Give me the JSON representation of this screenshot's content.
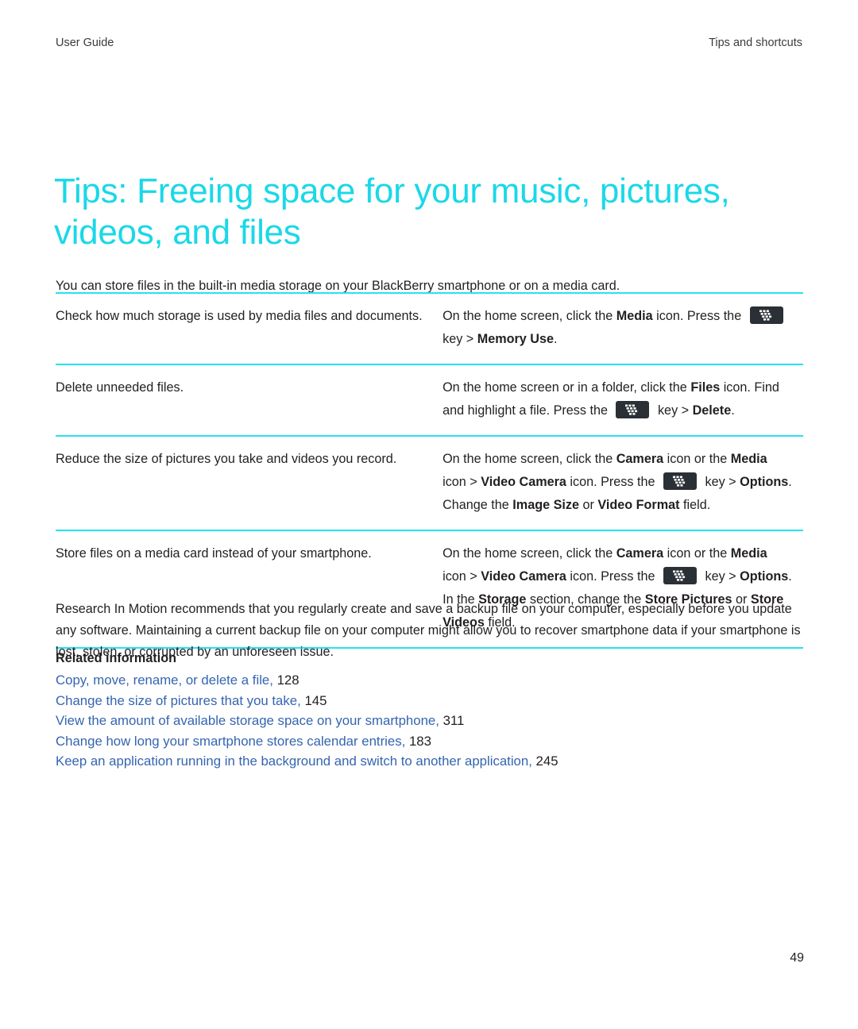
{
  "header": {
    "left": "User Guide",
    "right": "Tips and shortcuts"
  },
  "title": "Tips: Freeing space for your music, pictures, videos, and files",
  "intro": "You can store files in the built-in media storage on your BlackBerry smartphone or on a media card.",
  "colors": {
    "accent_cyan": "#1ad8e8",
    "rule_cyan": "#25e2f2",
    "link_blue": "#3565b0",
    "body_text": "#231f20",
    "key_icon_bg": "#2b3036"
  },
  "table": {
    "rows": [
      {
        "task": "Check how much storage is used by media files and documents.",
        "steps": [
          {
            "segments": [
              {
                "text": "On the home screen, click the ",
                "bold": false
              },
              {
                "text": "Media",
                "bold": true
              },
              {
                "text": " icon. Press the ",
                "bold": false
              },
              {
                "icon": "blackberry-menu-key-icon"
              }
            ]
          },
          {
            "segments": [
              {
                "text": "key > ",
                "bold": false
              },
              {
                "text": "Memory Use",
                "bold": true
              },
              {
                "text": ".",
                "bold": false
              }
            ]
          }
        ]
      },
      {
        "task": "Delete unneeded files.",
        "steps": [
          {
            "segments": [
              {
                "text": "On the home screen or in a folder, click the ",
                "bold": false
              },
              {
                "text": "Files",
                "bold": true
              },
              {
                "text": " icon. Find",
                "bold": false
              }
            ]
          },
          {
            "segments": [
              {
                "text": "and highlight a file. Press the ",
                "bold": false
              },
              {
                "icon": "blackberry-menu-key-icon"
              },
              {
                "text": " key > ",
                "bold": false
              },
              {
                "text": "Delete",
                "bold": true
              },
              {
                "text": ".",
                "bold": false
              }
            ]
          }
        ]
      },
      {
        "task": "Reduce the size of pictures you take and videos you record.",
        "steps": [
          {
            "segments": [
              {
                "text": "On the home screen, click the ",
                "bold": false
              },
              {
                "text": "Camera",
                "bold": true
              },
              {
                "text": " icon or the ",
                "bold": false
              },
              {
                "text": "Media",
                "bold": true
              }
            ]
          },
          {
            "segments": [
              {
                "text": "icon > ",
                "bold": false
              },
              {
                "text": "Video Camera",
                "bold": true
              },
              {
                "text": " icon. Press the ",
                "bold": false
              },
              {
                "icon": "blackberry-menu-key-icon"
              },
              {
                "text": " key > ",
                "bold": false
              },
              {
                "text": "Options",
                "bold": true
              },
              {
                "text": ".",
                "bold": false
              }
            ]
          },
          {
            "segments": [
              {
                "text": "Change the ",
                "bold": false
              },
              {
                "text": "Image Size",
                "bold": true
              },
              {
                "text": " or ",
                "bold": false
              },
              {
                "text": "Video Format",
                "bold": true
              },
              {
                "text": " field.",
                "bold": false
              }
            ]
          }
        ]
      },
      {
        "task": "Store files on a media card instead of your smartphone.",
        "steps": [
          {
            "segments": [
              {
                "text": "On the home screen, click the ",
                "bold": false
              },
              {
                "text": "Camera",
                "bold": true
              },
              {
                "text": " icon or the ",
                "bold": false
              },
              {
                "text": "Media",
                "bold": true
              }
            ]
          },
          {
            "segments": [
              {
                "text": "icon > ",
                "bold": false
              },
              {
                "text": "Video Camera",
                "bold": true
              },
              {
                "text": " icon. Press the ",
                "bold": false
              },
              {
                "icon": "blackberry-menu-key-icon"
              },
              {
                "text": " key > ",
                "bold": false
              },
              {
                "text": "Options",
                "bold": true
              },
              {
                "text": ".",
                "bold": false
              }
            ]
          },
          {
            "segments": [
              {
                "text": "In the ",
                "bold": false
              },
              {
                "text": "Storage",
                "bold": true
              },
              {
                "text": " section, change the ",
                "bold": false
              },
              {
                "text": "Store Pictures",
                "bold": true
              },
              {
                "text": " or ",
                "bold": false
              },
              {
                "text": "Store",
                "bold": true
              }
            ]
          },
          {
            "segments": [
              {
                "text": "Videos",
                "bold": true
              },
              {
                "text": " field.",
                "bold": false
              }
            ]
          }
        ]
      }
    ]
  },
  "closing": "Research In Motion recommends that you regularly create and save a backup file on your computer, especially before you update any software. Maintaining a current backup file on your computer might allow you to recover smartphone data if your smartphone is lost, stolen, or corrupted by an unforeseen issue.",
  "related": {
    "heading": "Related information",
    "links": [
      {
        "label": "Copy, move, rename, or delete a file,",
        "page": "128"
      },
      {
        "label": "Change the size of pictures that you take,",
        "page": "145"
      },
      {
        "label": "View the amount of available storage space on your smartphone,",
        "page": "311"
      },
      {
        "label": "Change how long your smartphone stores calendar entries,",
        "page": "183"
      },
      {
        "label": "Keep an application running in the background and switch to another application,",
        "page": "245"
      }
    ]
  },
  "folio": "49"
}
